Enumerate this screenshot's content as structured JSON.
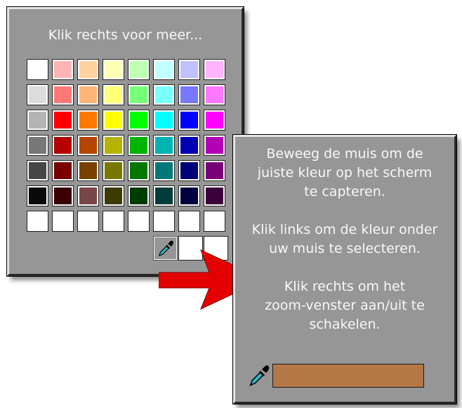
{
  "palette": {
    "title": "Klik rechts voor meer...",
    "rows": [
      [
        "#ffffff",
        "#ffb4b4",
        "#ffd2a0",
        "#ffffb4",
        "#c0ffb4",
        "#c0ffff",
        "#c0c0ff",
        "#ffb4ff"
      ],
      [
        "#dcdcdc",
        "#ff7878",
        "#ffb478",
        "#ffff78",
        "#78ff78",
        "#78ffff",
        "#7878ff",
        "#ff78ff"
      ],
      [
        "#b4b4b4",
        "#ff0000",
        "#ff7800",
        "#ffff00",
        "#00ff00",
        "#00ffff",
        "#0000ff",
        "#ff00ff"
      ],
      [
        "#787878",
        "#b40000",
        "#b44600",
        "#b4b400",
        "#00b400",
        "#00b4b4",
        "#0000b4",
        "#b400b4"
      ],
      [
        "#464646",
        "#780000",
        "#784100",
        "#787800",
        "#007800",
        "#007878",
        "#000078",
        "#780078"
      ],
      [
        "#0a0a0a",
        "#3c0000",
        "#784646",
        "#3c3c00",
        "#003c00",
        "#003c3c",
        "#00003c",
        "#3c003c"
      ],
      [
        "#ffffff",
        "#ffffff",
        "#ffffff",
        "#ffffff",
        "#ffffff",
        "#ffffff",
        "#ffffff",
        "#ffffff"
      ],
      [
        "eyedropper",
        "#ffffff",
        "#ffffff"
      ]
    ],
    "eyedropper_icon": "eyedropper-icon"
  },
  "picker": {
    "instructions": [
      "Beweeg de muis om de",
      "juiste kleur op het scherm",
      "te capteren.",
      "",
      "Klik links om de kleur onder",
      "uw muis te selecteren.",
      "",
      "Klik rechts om het",
      "zoom-venster aan/uit te",
      "schakelen."
    ],
    "preview_color": "#b47846",
    "icon": "eyedropper-icon"
  },
  "arrow": {
    "color": "#e40000",
    "icon": "right-arrow-icon"
  }
}
